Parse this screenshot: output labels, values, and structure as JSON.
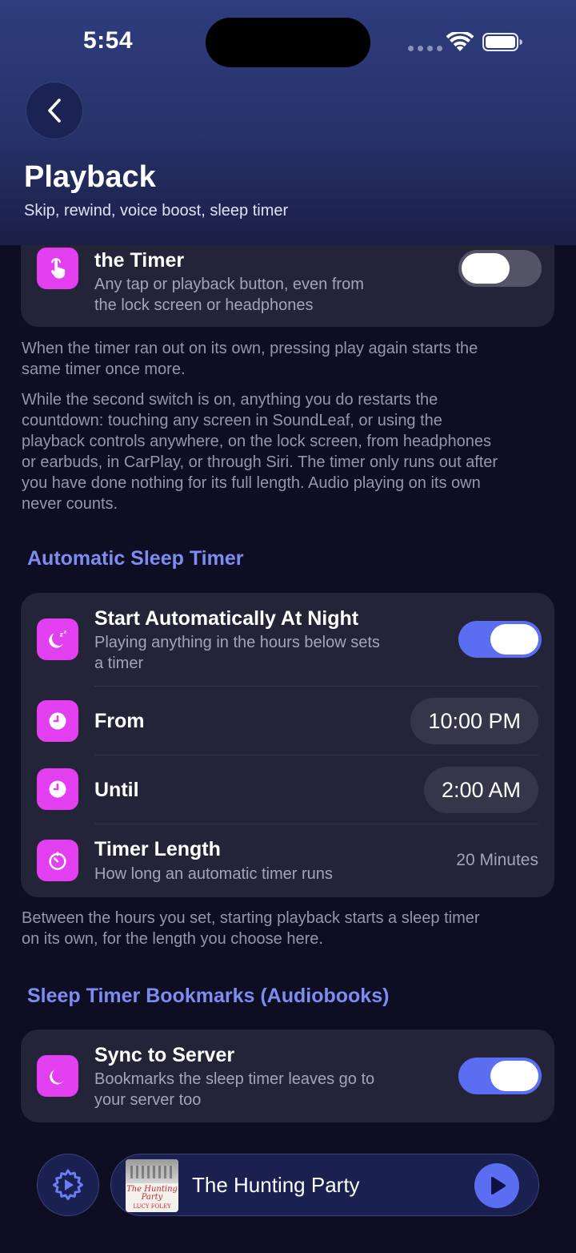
{
  "status_bar": {
    "time": "5:54"
  },
  "header": {
    "title": "Playback",
    "subtitle": "Skip, rewind, voice boost, sleep timer"
  },
  "reset_card": {
    "title": "the Timer",
    "subtitle_line1": "Any tap or playback button, even from",
    "subtitle_line2": "the lock screen or headphones",
    "toggle_on": false,
    "icon": "tap-hand-icon"
  },
  "notes": {
    "timer_note_1_line1": "When the timer ran out on its own, pressing play again starts the",
    "timer_note_1_line2": "same timer once more.",
    "timer_note_2_line1": "While the second switch is on, anything you do restarts the",
    "timer_note_2_line2": "countdown: touching any screen in SoundLeaf, or using the",
    "timer_note_2_line3": "playback controls anywhere, on the lock screen, from headphones",
    "timer_note_2_line4": "or earbuds, in CarPlay, or through Siri. The timer only runs out after",
    "timer_note_2_line5": "you have done nothing for its full length. Audio playing on its own",
    "timer_note_2_line6": "never counts.",
    "auto_note_line1": "Between the hours you set, starting playback starts a sleep timer",
    "auto_note_line2": "on its own, for the length you choose here."
  },
  "auto_section": {
    "label": "Automatic Sleep Timer",
    "start_title": "Start Automatically At Night",
    "start_sub_line1": "Playing anything in the hours below sets",
    "start_sub_line2": "a timer",
    "start_toggle_on": true,
    "from_label": "From",
    "from_value": "10:00 PM",
    "until_label": "Until",
    "until_value": "2:00 AM",
    "length_title": "Timer Length",
    "length_sub": "How long an automatic timer runs",
    "length_value": "20 Minutes"
  },
  "bookmarks_section": {
    "label": "Sleep Timer Bookmarks (Audiobooks)",
    "sync_title": "Sync to Server",
    "sync_sub_line1": "Bookmarks the sleep timer leaves go to",
    "sync_sub_line2": "your server too",
    "sync_toggle_on": true
  },
  "mini_player": {
    "track_title": "The Hunting Party",
    "cover_title": "The Hunting Party",
    "cover_author": "LUCY FOLEY"
  },
  "colors": {
    "accent": "#5b6df0",
    "icon_bg": "#e23ff0",
    "section_label": "#7e8cf2",
    "card_bg": "#242438",
    "page_bg": "#0e0e22"
  }
}
